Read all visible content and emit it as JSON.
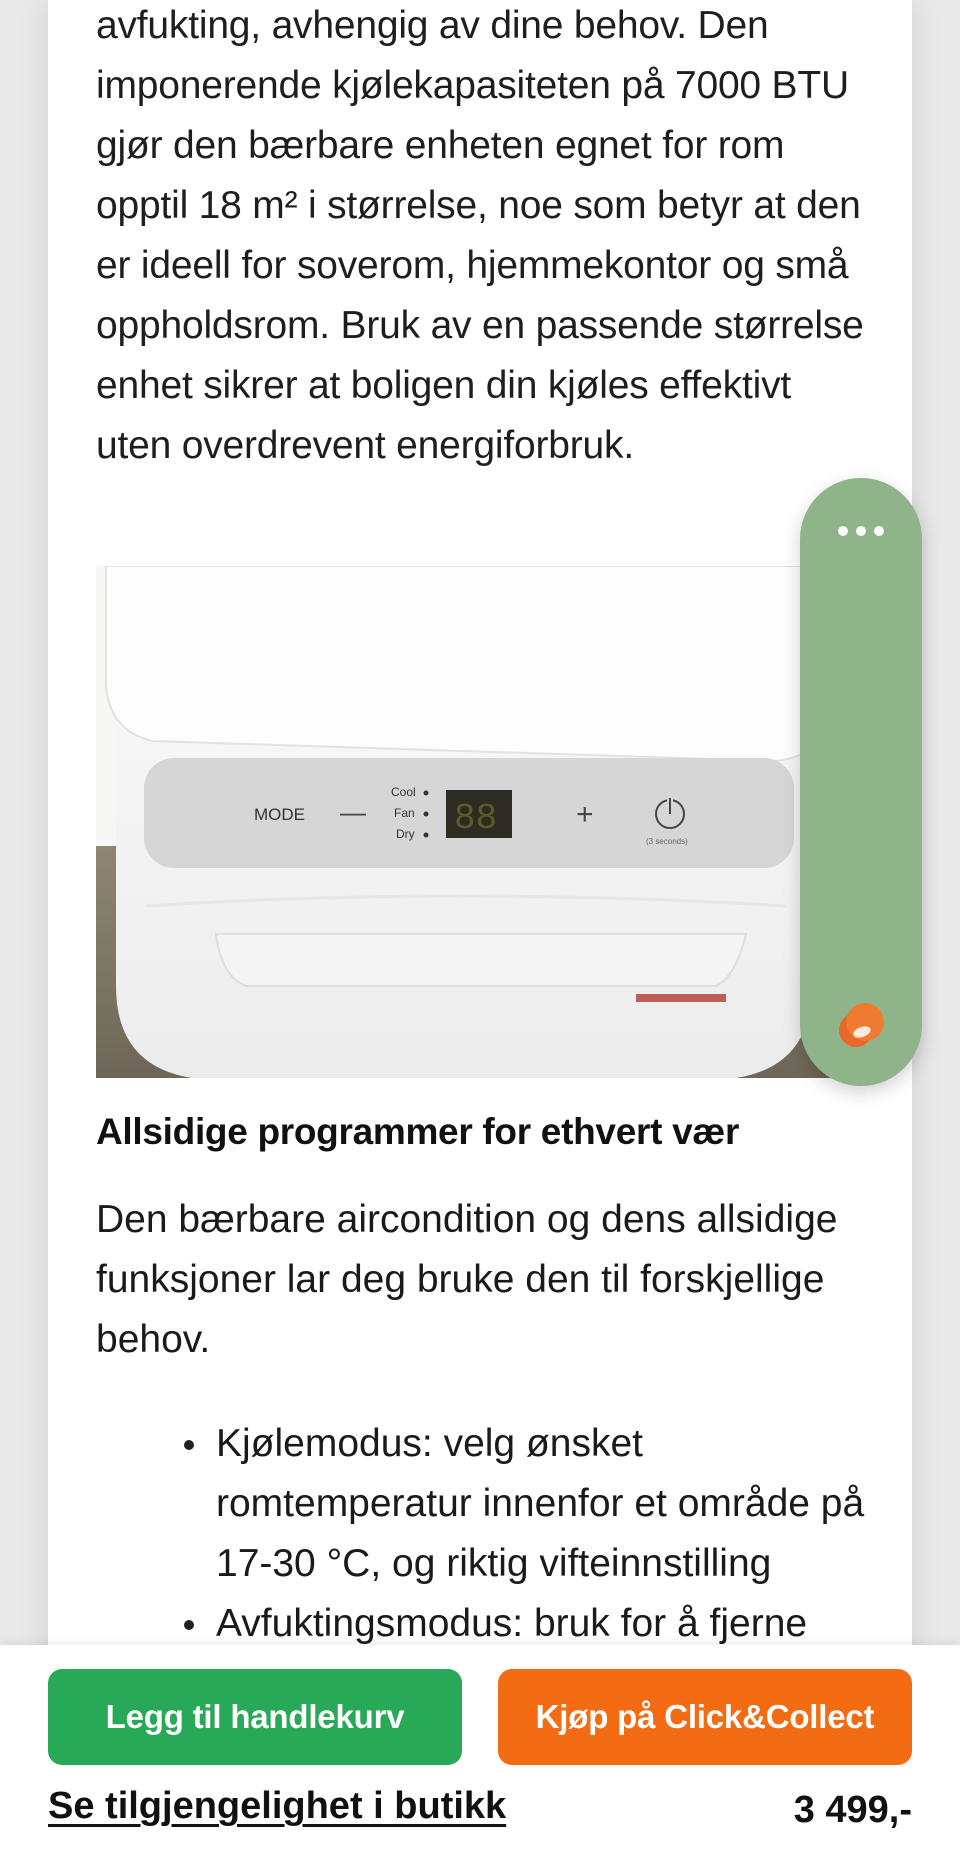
{
  "article": {
    "paragraph_intro": "avfukting, avhengig av dine behov. Den imponerende kjølekapasiteten på 7000 BTU gjør den bærbare enheten egnet for rom opptil 18 m² i størrelse, noe som betyr at den er ideell for soverom, hjemmekontor og små oppholdsrom. Bruk av en passende størrelse enhet sikrer at boligen din kjøles effektivt uten overdrevent energiforbruk.",
    "section_heading": "Allsidige programmer for ethvert vær",
    "paragraph_2": "Den bærbare aircondition og dens allsidige funksjoner lar deg bruke den til forskjellige behov.",
    "bullets": [
      "Kjølemodus: velg ønsket romtemperatur innenfor et område på 17-30 °C, og riktig vifteinnstilling",
      "Avfuktingsmodus: bruk for å fjerne"
    ]
  },
  "product_image": {
    "panel_mode": "MODE",
    "panel_minus": "—",
    "panel_plus": "+",
    "mode_cool": "Cool",
    "mode_fan": "Fan",
    "mode_dry": "Dry",
    "display_digits": "88",
    "wifi_hint": "(3 seconds)"
  },
  "side_widget": {
    "more_icon": "more-horizontal-icon",
    "chat_icon": "chat-bubble-icon",
    "color": "#8fb48a"
  },
  "bottom_bar": {
    "add_to_cart_label": "Legg til handlekurv",
    "click_collect_label": "Kjøp på Click&Collect",
    "availability_link": "Se tilgjengelighet i butikk",
    "price": "3 499,-"
  },
  "colors": {
    "green_button": "#27a957",
    "orange_button": "#f36b12"
  }
}
